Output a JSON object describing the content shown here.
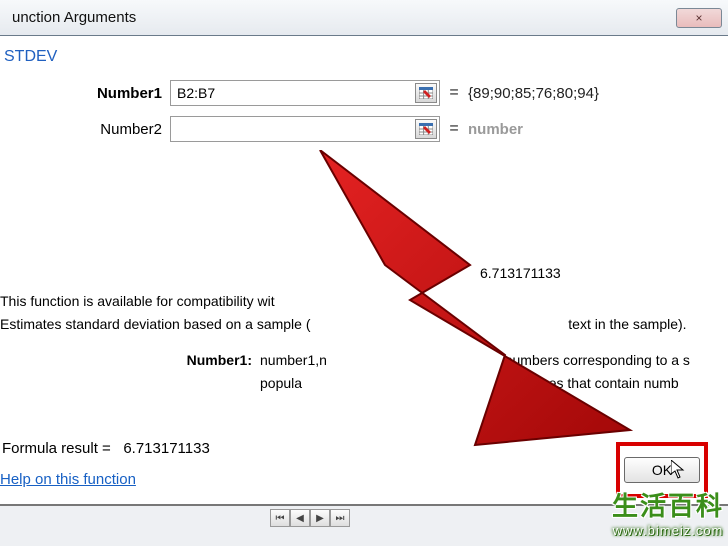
{
  "window": {
    "title": "unction Arguments",
    "close_glyph": "×"
  },
  "function": {
    "name": "STDEV"
  },
  "args": [
    {
      "label": "Number1",
      "bold": true,
      "value": "B2:B7",
      "preview": "{89;90;85;76;80;94}",
      "preview_muted": false
    },
    {
      "label": "Number2",
      "bold": false,
      "value": "",
      "preview": "number",
      "preview_muted": true
    }
  ],
  "calc_preview": "6.713171133",
  "description": {
    "line1": "This function is available for compatibility wit",
    "line2": "Estimates standard deviation based on a sample (",
    "line2_tail": "text in the sample)."
  },
  "arg_help": {
    "label": "Number1:",
    "text_head": "number1,n",
    "text_tail_a": "numbers corresponding to a s",
    "text_line2_head": "popula",
    "text_line2_tail": "ferences that contain numb"
  },
  "formula_result": {
    "label": "Formula result  =",
    "value": "6.713171133"
  },
  "help_link": "Help on this function",
  "ok_button": "OK",
  "watermark": {
    "cn": "生活百科",
    "url": "www.bimeiz.com"
  }
}
